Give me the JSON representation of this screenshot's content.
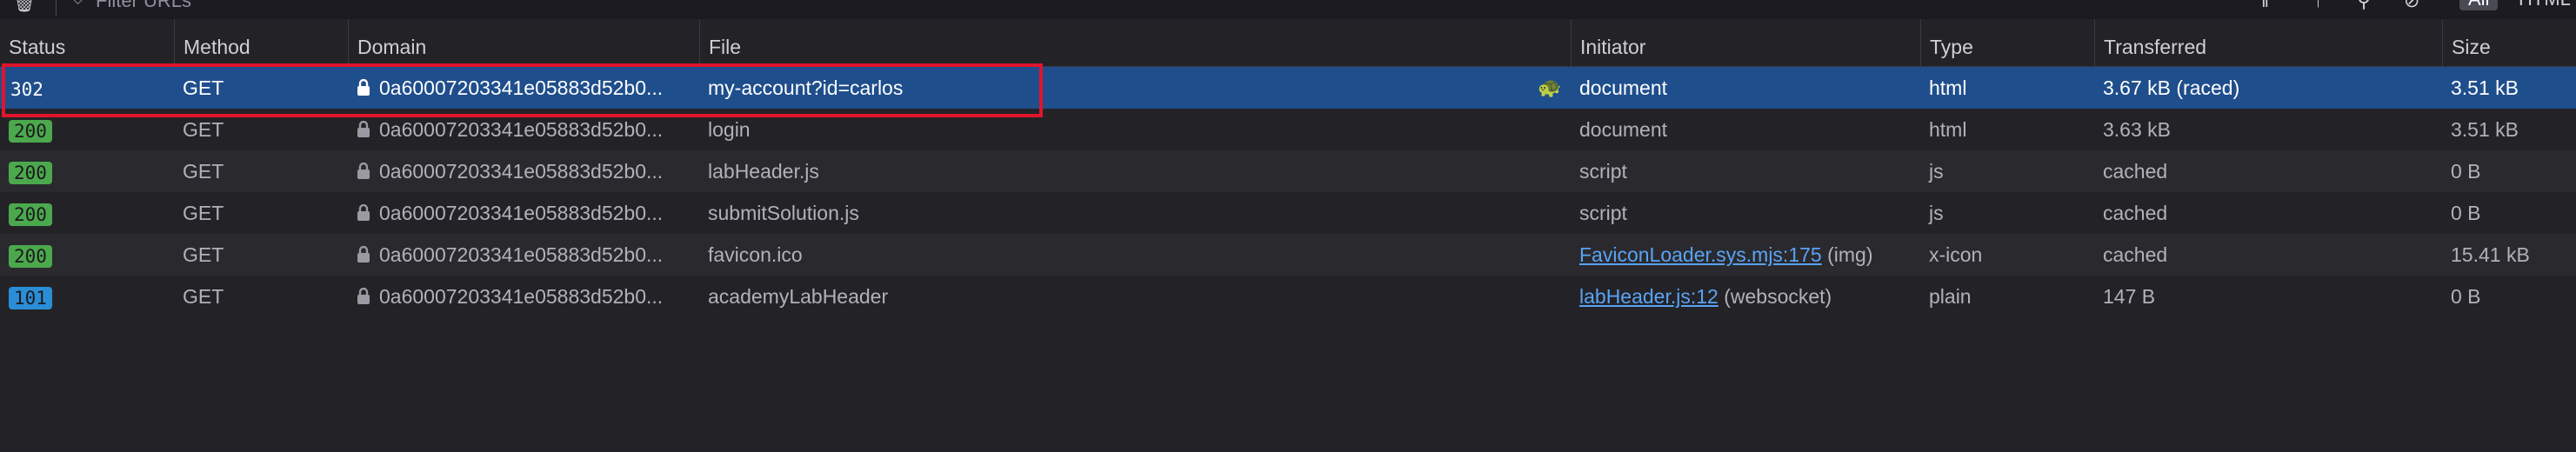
{
  "toolbar": {
    "filter_placeholder": "Filter URLs",
    "chip_all": "All",
    "chip_html": "HTML"
  },
  "columns": {
    "status": "Status",
    "method": "Method",
    "domain": "Domain",
    "file": "File",
    "initiator": "Initiator",
    "type": "Type",
    "transferred": "Transferred",
    "size": "Size"
  },
  "rows": [
    {
      "status": "302",
      "method": "GET",
      "domain": "0a60007203341e05883d52b0...",
      "file": "my-account?id=carlos",
      "initiator": "document",
      "initiator_link": "",
      "initiator_suffix": "",
      "type": "html",
      "transferred": "3.67 kB (raced)",
      "size": "3.51 kB"
    },
    {
      "status": "200",
      "method": "GET",
      "domain": "0a60007203341e05883d52b0...",
      "file": "login",
      "initiator": "document",
      "initiator_link": "",
      "initiator_suffix": "",
      "type": "html",
      "transferred": "3.63 kB",
      "size": "3.51 kB"
    },
    {
      "status": "200",
      "method": "GET",
      "domain": "0a60007203341e05883d52b0...",
      "file": "labHeader.js",
      "initiator": "script",
      "initiator_link": "",
      "initiator_suffix": "",
      "type": "js",
      "transferred": "cached",
      "size": "0 B"
    },
    {
      "status": "200",
      "method": "GET",
      "domain": "0a60007203341e05883d52b0...",
      "file": "submitSolution.js",
      "initiator": "script",
      "initiator_link": "",
      "initiator_suffix": "",
      "type": "js",
      "transferred": "cached",
      "size": "0 B"
    },
    {
      "status": "200",
      "method": "GET",
      "domain": "0a60007203341e05883d52b0...",
      "file": "favicon.ico",
      "initiator": "",
      "initiator_link": "FaviconLoader.sys.mjs:175",
      "initiator_suffix": " (img)",
      "type": "x-icon",
      "transferred": "cached",
      "size": "15.41 kB"
    },
    {
      "status": "101",
      "method": "GET",
      "domain": "0a60007203341e05883d52b0...",
      "file": "academyLabHeader",
      "initiator": "",
      "initiator_link": "labHeader.js:12",
      "initiator_suffix": " (websocket)",
      "type": "plain",
      "transferred": "147 B",
      "size": "0 B"
    }
  ],
  "colors": {
    "selected_row": "#1f4e8c",
    "highlight_border": "#e0142c",
    "status_200": "#4ca84c",
    "status_101": "#2b8dd6",
    "link": "#5aa3f5"
  }
}
